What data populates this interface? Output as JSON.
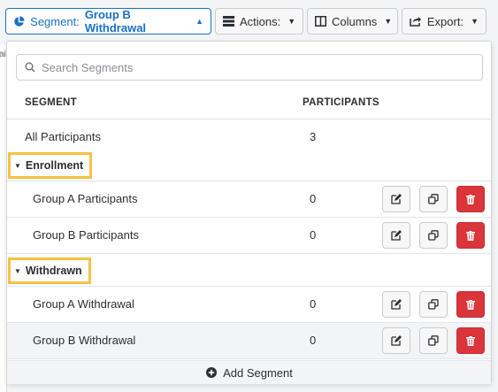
{
  "toolbar": {
    "segment_label": "Segment:",
    "segment_value": "Group B Withdrawal",
    "actions_label": "Actions:",
    "columns_label": "Columns",
    "export_label": "Export:"
  },
  "background_fragment": "ai",
  "search": {
    "placeholder": "Search Segments"
  },
  "table": {
    "headers": {
      "segment": "SEGMENT",
      "participants": "PARTICIPANTS"
    },
    "all_row": {
      "name": "All Participants",
      "count": "3"
    },
    "groups": [
      {
        "label": "Enrollment",
        "rows": [
          {
            "name": "Group A Participants",
            "count": "0"
          },
          {
            "name": "Group B Participants",
            "count": "0"
          }
        ]
      },
      {
        "label": "Withdrawn",
        "rows": [
          {
            "name": "Group A Withdrawal",
            "count": "0"
          },
          {
            "name": "Group B Withdrawal",
            "count": "0"
          }
        ]
      }
    ]
  },
  "footer": {
    "add_label": "Add Segment"
  },
  "colors": {
    "accent": "#1a6fc4",
    "highlight": "#f5c242",
    "danger": "#d9353b"
  }
}
